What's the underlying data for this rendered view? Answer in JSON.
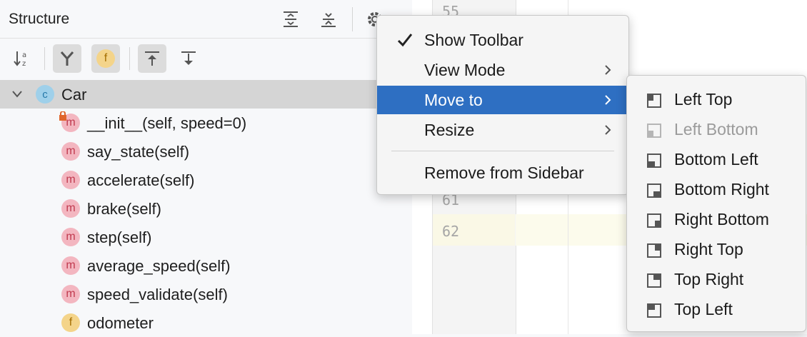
{
  "panel": {
    "title": "Structure",
    "header_icons": [
      "expand-all-icon",
      "collapse-all-icon",
      "gear-icon"
    ],
    "toolbar_icons": [
      "sort-alphabetically-icon",
      "show-inherited-icon",
      "show-fields-icon",
      "autoscroll-to-source-icon",
      "autoscroll-from-source-icon"
    ]
  },
  "tree": {
    "root": {
      "label": "Car",
      "badge": "c"
    },
    "items": [
      {
        "label": "__init__(self, speed=0)",
        "badge": "m",
        "locked": true
      },
      {
        "label": "say_state(self)",
        "badge": "m"
      },
      {
        "label": "accelerate(self)",
        "badge": "m"
      },
      {
        "label": "brake(self)",
        "badge": "m"
      },
      {
        "label": "step(self)",
        "badge": "m"
      },
      {
        "label": "average_speed(self)",
        "badge": "m"
      },
      {
        "label": "speed_validate(self)",
        "badge": "m"
      },
      {
        "label": "odometer",
        "badge": "f"
      }
    ]
  },
  "editor": {
    "line_numbers": [
      "55",
      "61",
      "62"
    ]
  },
  "context_menu": {
    "items": [
      {
        "label": "Show Toolbar",
        "checked": true
      },
      {
        "label": "View Mode",
        "submenu": true
      },
      {
        "label": "Move to",
        "submenu": true,
        "highlighted": true
      },
      {
        "label": "Resize",
        "submenu": true
      },
      {
        "label": "Remove from Sidebar"
      }
    ]
  },
  "submenu": {
    "items": [
      {
        "label": "Left Top"
      },
      {
        "label": "Left Bottom",
        "disabled": true
      },
      {
        "label": "Bottom Left"
      },
      {
        "label": "Bottom Right"
      },
      {
        "label": "Right Bottom"
      },
      {
        "label": "Right Top"
      },
      {
        "label": "Top Right"
      },
      {
        "label": "Top Left"
      }
    ]
  },
  "colors": {
    "highlight": "#2e6fc2",
    "method_badge": "#f3b6c0",
    "field_badge": "#f4d48a",
    "class_badge": "#9fd0ea"
  }
}
